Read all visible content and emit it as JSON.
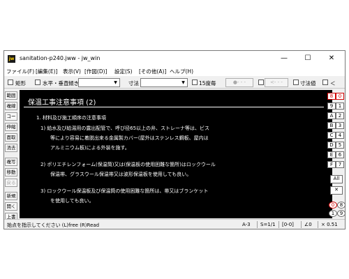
{
  "window": {
    "title": "sanitation-p240.jww - jw_win",
    "app_icon_text": "jw",
    "minimize": "—",
    "maximize": "☐",
    "close": "✕"
  },
  "menu": [
    "ファイル(F)",
    "[編集(E)]",
    "表示(V)",
    "[作図(D)]",
    "設定(S)",
    "[その他(A)]",
    "ヘルプ(H)"
  ],
  "toolbar": {
    "rect": "矩形",
    "hv": "水平・垂直",
    "angle": "傾き",
    "size": "寸法",
    "deg15": "15度毎",
    "dim_value": "寸法値",
    "lt": "＜"
  },
  "left_tools": [
    "範囲",
    "複線",
    "コーナー",
    "伸縮",
    "面取",
    "消去",
    "複写",
    "移動",
    "戻る",
    "新規",
    "開く",
    "上書"
  ],
  "right_layers": [
    "0",
    "8",
    "1",
    "9",
    "2",
    "A",
    "3",
    "B",
    "4",
    "C",
    "5",
    "D",
    "6",
    "E",
    "7",
    "F"
  ],
  "right_extra": {
    "all": "All",
    "x": "✕"
  },
  "right_bottom": [
    "0",
    "8",
    "1",
    "9",
    "2",
    "A"
  ],
  "drawing": {
    "heading": "保温工事注意事項 (2)",
    "lines": [
      "1. 材料及び施工順序の注意事項",
      "1) 給水及び給湯用の露出配管で、呼び径65以上の弁、ストレーナ等は、ビス",
      "等により容易に着脱出来る金属製カバー(屋外はステンレス鋼板、屋内は",
      "アルミニウム板)による外装を施す。",
      "2) ポリエチレンフォーム(保温筒)又は(保温板の使用困難な箇所)はロックウール",
      "保温帯、グラスウール保温帯又は波形保温板を使用しても良い。",
      "3) ロックウール保温板及び保温筒の使用困難な箇所は、帯又はブランケット",
      "を使用しても良い。"
    ]
  },
  "status": {
    "message": "始点を指示してください (L)free (R)Read",
    "paper": "A-3",
    "scale": "S=1/1",
    "layer": "[0-0]",
    "angle": "∠0",
    "zoom": "× 0.51"
  }
}
